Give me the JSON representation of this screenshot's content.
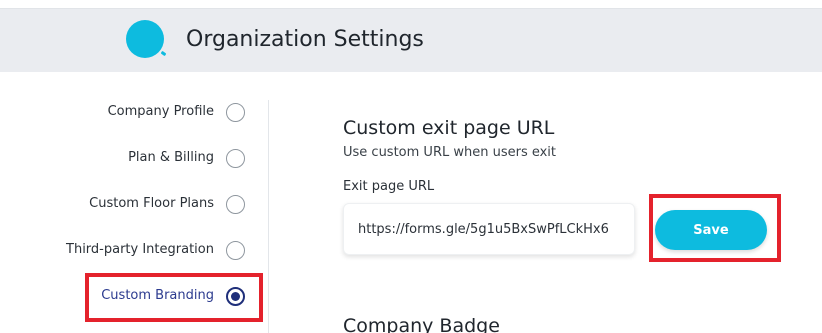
{
  "header": {
    "title": "Organization Settings",
    "logo_icon": "circle-logo-icon",
    "logo_color": "#0dbbdf"
  },
  "sidebar": {
    "items": [
      {
        "label": "Company Profile",
        "selected": false
      },
      {
        "label": "Plan & Billing",
        "selected": false
      },
      {
        "label": "Custom Floor Plans",
        "selected": false
      },
      {
        "label": "Third-party Integration",
        "selected": false
      },
      {
        "label": "Custom Branding",
        "selected": true
      }
    ]
  },
  "main": {
    "section_title": "Custom exit page URL",
    "section_description": "Use custom URL when users exit",
    "field_label": "Exit page URL",
    "url_value": "https://forms.gle/5g1u5BxSwPfLCkHx6",
    "save_label": "Save",
    "next_section_title": "Company Badge"
  },
  "colors": {
    "accent": "#0dbbdf",
    "selected_radio": "#1f2f7a",
    "highlight": "#e4222c"
  }
}
